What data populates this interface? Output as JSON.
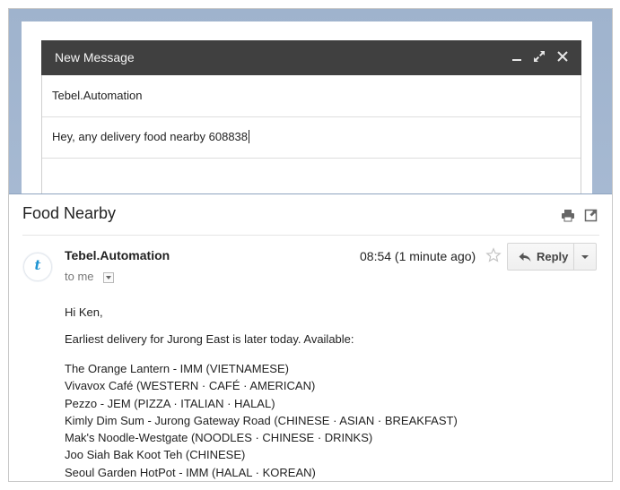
{
  "compose": {
    "title": "New Message",
    "to_value": "Tebel.Automation",
    "subject_value": "Hey, any delivery food nearby 608838",
    "controls": {
      "minimize": "minimize-icon",
      "expand": "expand-icon",
      "close": "close-icon"
    }
  },
  "thread": {
    "subject": "Food Nearby",
    "icons": [
      "print-icon",
      "new-window-icon"
    ]
  },
  "message": {
    "avatar_letter": "t",
    "sender": "Tebel.Automation",
    "recipient_label": "to me",
    "timestamp": "08:54 (1 minute ago)",
    "reply_label": "Reply",
    "greeting": "Hi Ken,",
    "intro": "Earliest delivery for Jurong East is later today. Available:",
    "restaurants": [
      "The Orange Lantern - IMM (VIETNAMESE)",
      "Vivavox Café (WESTERN  ·  CAFÉ  ·  AMERICAN)",
      "Pezzo - JEM (PIZZA  ·  ITALIAN  ·  HALAL)",
      "Kimly Dim Sum - Jurong Gateway Road (CHINESE  ·  ASIAN  ·  BREAKFAST)",
      "Mak's Noodle-Westgate (NOODLES  ·  CHINESE  ·  DRINKS)",
      "Joo Siah Bak Koot Teh (CHINESE)",
      "Seoul Garden HotPot - IMM (HALAL  ·  KOREAN)"
    ]
  },
  "colors": {
    "panel_blue": "#a3b6cf",
    "compose_header": "#404040",
    "avatar_blue": "#1d93d2"
  }
}
